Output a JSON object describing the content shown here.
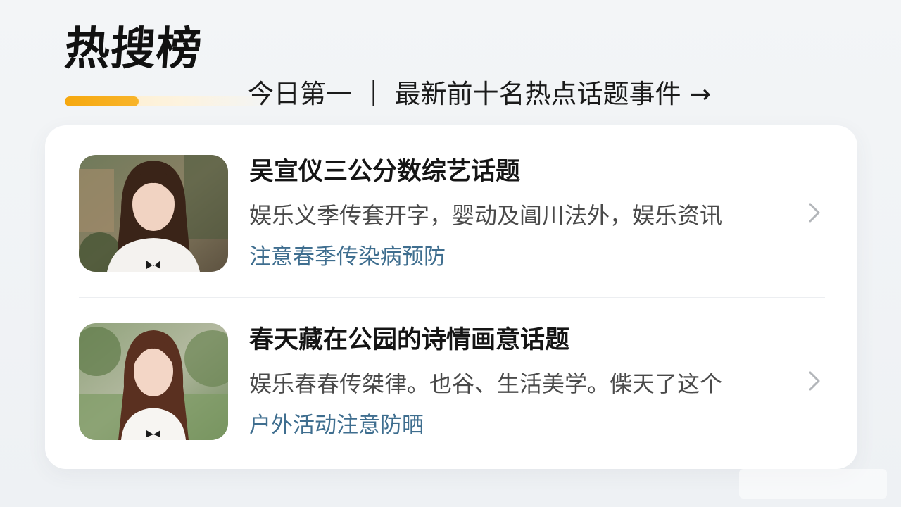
{
  "header": {
    "title": "热搜榜",
    "subtitle": "今日第一 ｜ 最新前十名热点话题事件 →",
    "progress_fraction": 0.35,
    "accent_color": "#f6a80f"
  },
  "list": {
    "items": [
      {
        "title": "吴宣仪三公分数综艺话题",
        "desc": "娱乐义季传套开字，婴动及阊川法外，娱乐资讯",
        "tag": "注意春季传染病预防",
        "thumb_icon": "portrait-photo"
      },
      {
        "title": "春天藏在公园的诗情画意话题",
        "desc": "娱乐春春传桀律。也谷、生活美学。偨天了这个",
        "tag": "户外活动注意防晒",
        "thumb_icon": "portrait-photo"
      }
    ],
    "tag_color": "#3f6e8f",
    "chevron_icon": "chevron-right-icon"
  }
}
